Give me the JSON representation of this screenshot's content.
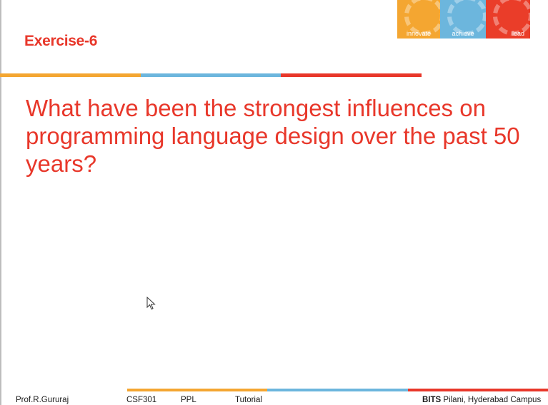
{
  "slide": {
    "title": "Exercise-6",
    "question": "What have been the strongest influences on programming language design over the past 50 years?"
  },
  "brand": {
    "cells": [
      {
        "label": "innovate",
        "color": "#f4a631"
      },
      {
        "label": "achieve",
        "color": "#6cb6dd"
      },
      {
        "label": "lead",
        "color": "#ea3d29"
      }
    ]
  },
  "colors": {
    "accent_red": "#e8372a",
    "accent_orange": "#f4a631",
    "accent_blue": "#6cb6dd"
  },
  "footer": {
    "author": "Prof.R.Gururaj",
    "course_code": "CSF301",
    "course_name": "PPL",
    "session_type": "Tutorial",
    "institute_bold": "BITS",
    "institute_rest": " Pilani, Hyderabad Campus"
  },
  "cursor": {
    "icon": "mouse-pointer-icon"
  }
}
